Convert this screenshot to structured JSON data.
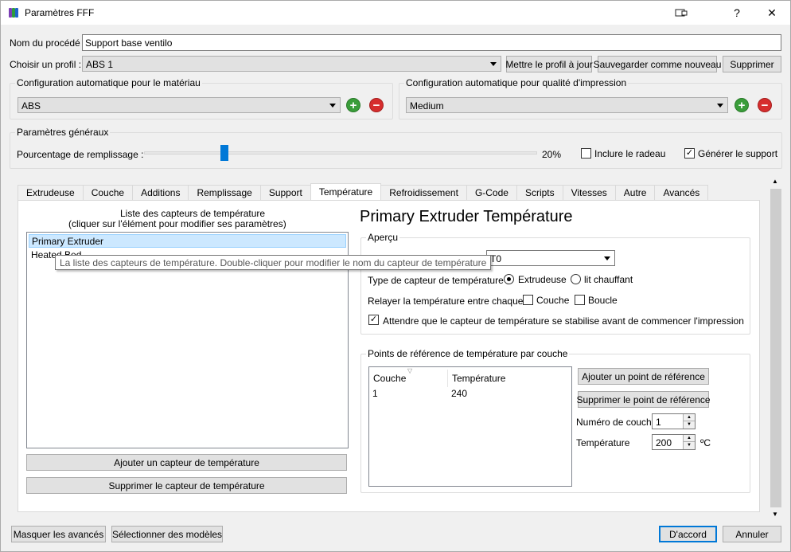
{
  "window": {
    "title": "Paramètres FFF"
  },
  "header": {
    "process_label": "Nom du procédé :",
    "process_value": "Support base ventilo",
    "profile_label": "Choisir un profil :",
    "profile_value": "ABS 1",
    "update_profile": "Mettre le profil à jour",
    "save_as_new": "Sauvegarder comme nouveau",
    "delete": "Supprimer"
  },
  "material": {
    "title": "Configuration automatique pour le matériau",
    "value": "ABS"
  },
  "quality": {
    "title": "Configuration automatique pour qualité d'impression",
    "value": "Medium"
  },
  "general": {
    "title": "Paramètres généraux",
    "infill_label": "Pourcentage de remplissage :",
    "infill_value": "20%",
    "infill_fraction": 0.2,
    "raft_label": "Inclure le radeau",
    "raft_checked": false,
    "support_label": "Générer le support",
    "support_checked": true
  },
  "tabs": [
    {
      "label": "Extrudeuse"
    },
    {
      "label": "Couche"
    },
    {
      "label": "Additions"
    },
    {
      "label": "Remplissage"
    },
    {
      "label": "Support"
    },
    {
      "label": "Température",
      "active": true
    },
    {
      "label": "Refroidissement"
    },
    {
      "label": "G-Code"
    },
    {
      "label": "Scripts"
    },
    {
      "label": "Vitesses"
    },
    {
      "label": "Autre"
    },
    {
      "label": "Avancés"
    }
  ],
  "sensors": {
    "header_line1": "Liste des capteurs de température",
    "header_line2": "(cliquer sur l'élément pour modifier ses paramètres)",
    "items": [
      "Primary Extruder",
      "Heated Bed"
    ],
    "selected_index": 0,
    "tooltip": "La liste des capteurs de température. Double-cliquer pour modifier le nom du capteur de température",
    "add_button": "Ajouter un capteur de température",
    "remove_button": "Supprimer le capteur de température"
  },
  "detail": {
    "title": "Primary Extruder Température",
    "overview_title": "Aperçu",
    "extruder_select": "T0",
    "sensor_type_label": "Type de capteur de température :",
    "sensor_type_extruder": "Extrudeuse",
    "sensor_type_bed": "lit chauffant",
    "relay_label": "Relayer la température entre chaque :",
    "relay_layer": "Couche",
    "relay_loop": "Boucle",
    "wait_label": "Attendre que le capteur de température se stabilise avant de commencer l'impression",
    "wait_checked": true,
    "setpoints_title": "Points de référence de température par couche",
    "columns": [
      "Couche",
      "Température"
    ],
    "rows": [
      [
        "1",
        "240"
      ]
    ],
    "add_setpoint": "Ajouter un point de référence",
    "remove_setpoint": "Supprimer le point de référence",
    "layer_number_label": "Numéro de couche",
    "layer_number_value": "1",
    "temperature_label": "Température",
    "temperature_value": "200",
    "temperature_unit": "ºC"
  },
  "footer": {
    "hide_advanced": "Masquer les avancés",
    "select_models": "Sélectionner des modèles",
    "ok": "D'accord",
    "cancel": "Annuler"
  },
  "colors": {
    "accent": "#0078d7",
    "selection": "#cce8ff",
    "add_green": "#3a9d3a",
    "remove_red": "#d62d2d"
  }
}
